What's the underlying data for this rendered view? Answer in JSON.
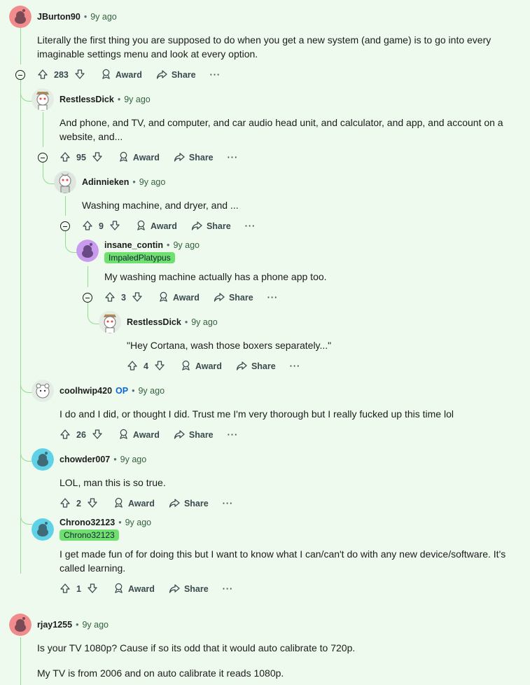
{
  "labels": {
    "award": "Award",
    "share": "Share",
    "more": "···",
    "separator": "•"
  },
  "colors": {
    "background": "#eefaee",
    "thread_line": "#8fdc8f",
    "flair_bg": "#6fe06f",
    "op_blue": "#0a66d8"
  },
  "comments": [
    {
      "user": "JBurton90",
      "time": "9y ago",
      "votes": "283",
      "text": "Literally the first thing you are supposed to do when you get a new system (and game) is to go into every imaginable settings menu and look at every option."
    },
    {
      "user": "RestlessDick",
      "time": "9y ago",
      "votes": "95",
      "text": "And phone, and TV, and computer, and car audio head unit, and calculator, and app, and account on a website, and..."
    },
    {
      "user": "Adinnieken",
      "time": "9y ago",
      "votes": "9",
      "text": "Washing machine, and dryer, and ..."
    },
    {
      "user": "insane_contin",
      "time": "9y ago",
      "flair": "ImpaledPlatypus",
      "votes": "3",
      "text": "My washing machine actually has a phone app too."
    },
    {
      "user": "RestlessDick",
      "time": "9y ago",
      "votes": "4",
      "text": "\"Hey Cortana, wash those boxers separately...\""
    },
    {
      "user": "coolhwip420",
      "op": "OP",
      "time": "9y ago",
      "votes": "26",
      "text": "I do and I did, or thought I did. Trust me I'm very thorough but I really fucked up this time lol"
    },
    {
      "user": "chowder007",
      "time": "9y ago",
      "votes": "2",
      "text": "LOL, man this is so true."
    },
    {
      "user": "Chrono32123",
      "time": "9y ago",
      "flair": "Chrono32123",
      "votes": "1",
      "text": "I get made fun of for doing this but I want to know what I can/can't do with any new device/software. It's called learning."
    },
    {
      "user": "rjay1255",
      "time": "9y ago",
      "text": "Is your TV 1080p? Cause if so its odd that it would auto calibrate to 720p.",
      "text2": "My TV is from 2006 and on auto calibrate it reads 1080p."
    }
  ]
}
